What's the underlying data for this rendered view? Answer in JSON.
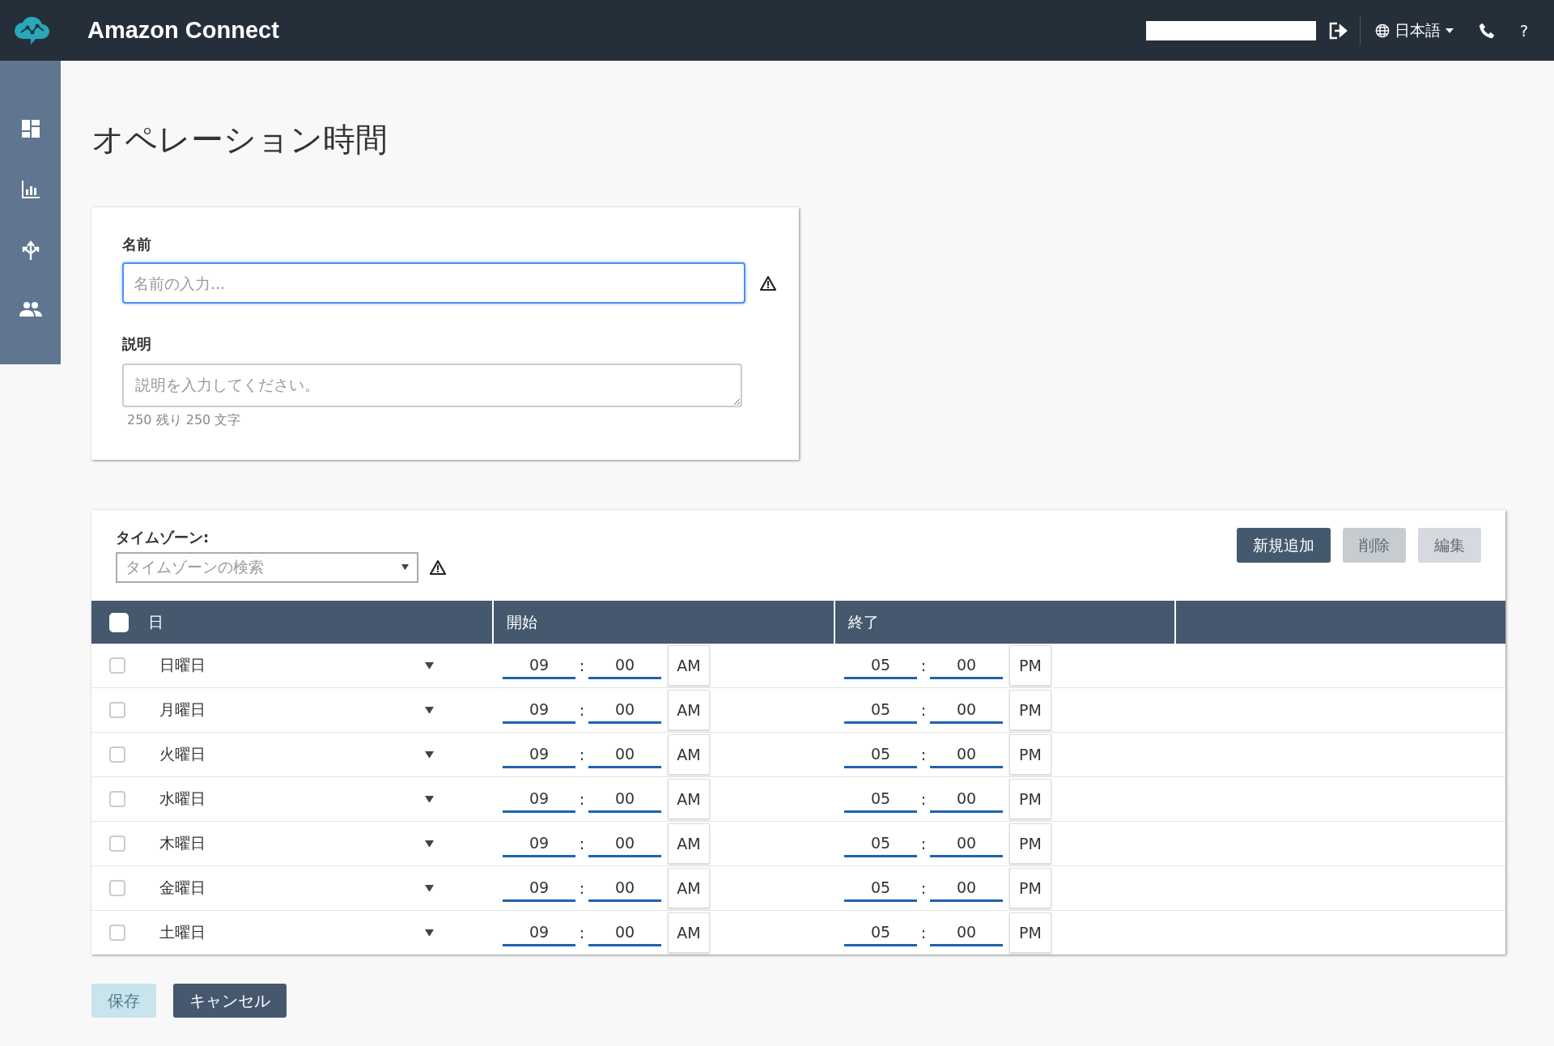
{
  "header": {
    "title": "Amazon Connect",
    "language": "日本語",
    "help": "?"
  },
  "page_title": "オペレーション時間",
  "form": {
    "name_label": "名前",
    "name_placeholder": "名前の入力...",
    "description_label": "説明",
    "description_placeholder": "説明を入力してください。",
    "char_count": "250 残り 250 文字"
  },
  "timezone": {
    "label": "タイムゾーン:",
    "placeholder": "タイムゾーンの検索"
  },
  "toolbar": [
    {
      "label": "新規追加",
      "disabled": false
    },
    {
      "label": "削除",
      "disabled": true
    },
    {
      "label": "編集",
      "disabled": true
    }
  ],
  "table": {
    "select_all_checked": false,
    "columns": [
      "日",
      "開始",
      "終了"
    ],
    "rows": [
      {
        "day": "日曜日",
        "checked": false,
        "start_hour": "09",
        "start_separator": ":",
        "start_minute": "00",
        "start_period": "AM",
        "end_hour": "05",
        "end_separator": ":",
        "end_minute": "00",
        "end_period": "PM"
      },
      {
        "day": "月曜日",
        "checked": false,
        "start_hour": "09",
        "start_separator": ":",
        "start_minute": "00",
        "start_period": "AM",
        "end_hour": "05",
        "end_separator": ":",
        "end_minute": "00",
        "end_period": "PM"
      },
      {
        "day": "火曜日",
        "checked": false,
        "start_hour": "09",
        "start_separator": ":",
        "start_minute": "00",
        "start_period": "AM",
        "end_hour": "05",
        "end_separator": ":",
        "end_minute": "00",
        "end_period": "PM"
      },
      {
        "day": "水曜日",
        "checked": false,
        "start_hour": "09",
        "start_separator": ":",
        "start_minute": "00",
        "start_period": "AM",
        "end_hour": "05",
        "end_separator": ":",
        "end_minute": "00",
        "end_period": "PM"
      },
      {
        "day": "木曜日",
        "checked": false,
        "start_hour": "09",
        "start_separator": ":",
        "start_minute": "00",
        "start_period": "AM",
        "end_hour": "05",
        "end_separator": ":",
        "end_minute": "00",
        "end_period": "PM"
      },
      {
        "day": "金曜日",
        "checked": false,
        "start_hour": "09",
        "start_separator": ":",
        "start_minute": "00",
        "start_period": "AM",
        "end_hour": "05",
        "end_separator": ":",
        "end_minute": "00",
        "end_period": "PM"
      },
      {
        "day": "土曜日",
        "checked": false,
        "start_hour": "09",
        "start_separator": ":",
        "start_minute": "00",
        "start_period": "AM",
        "end_hour": "05",
        "end_separator": ":",
        "end_minute": "00",
        "end_period": "PM"
      }
    ]
  },
  "footer": [
    {
      "label": "保存",
      "disabled": true
    },
    {
      "label": "キャンセル",
      "disabled": false
    }
  ]
}
